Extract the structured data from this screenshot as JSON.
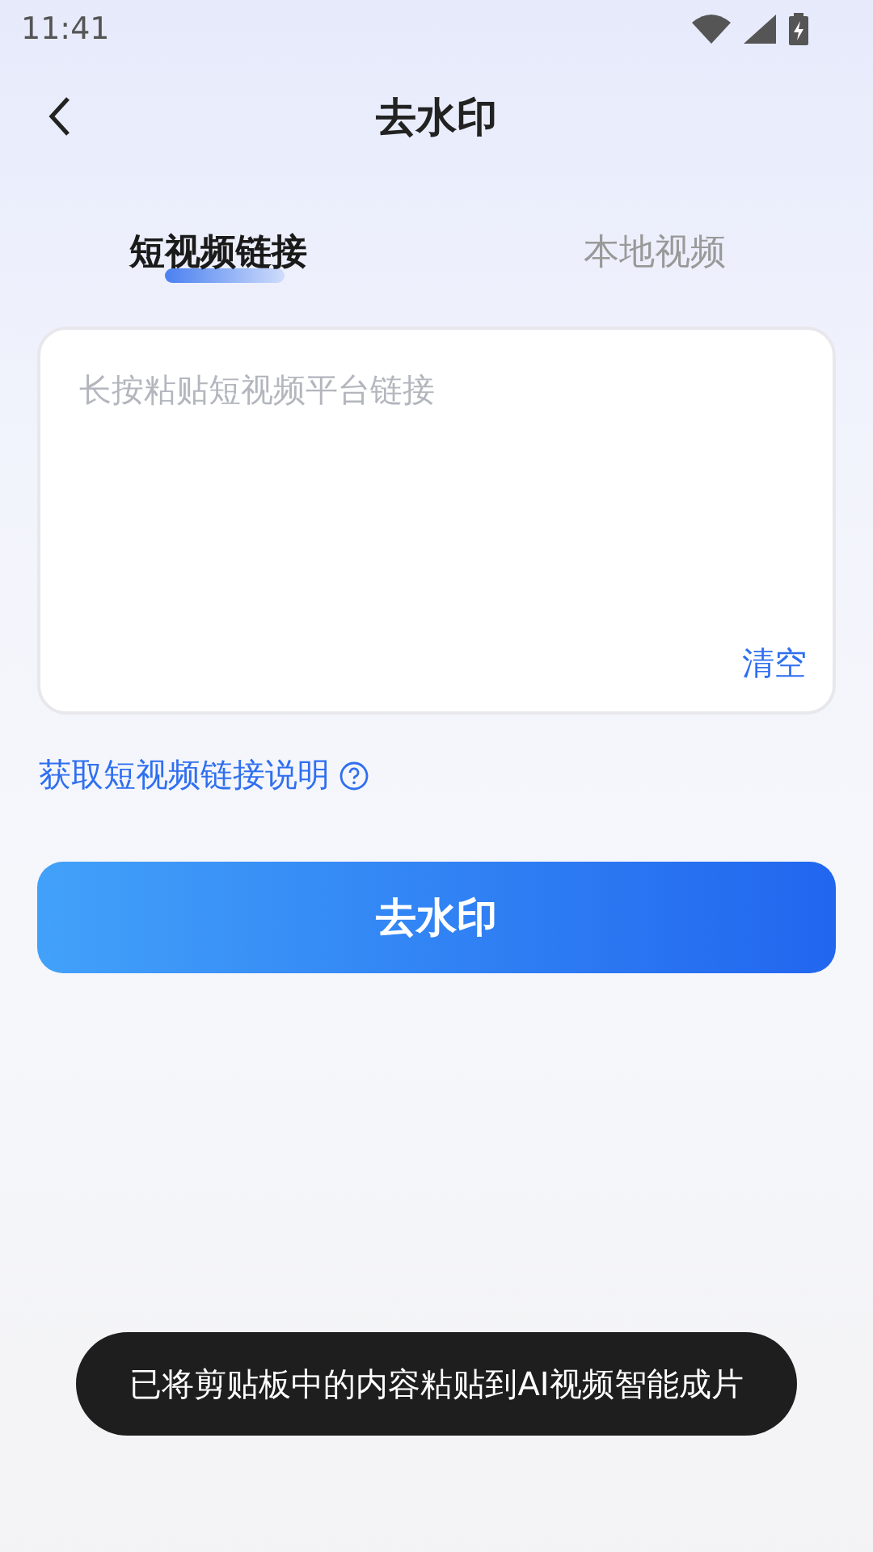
{
  "status_bar": {
    "time": "11:41"
  },
  "header": {
    "title": "去水印"
  },
  "tabs": [
    {
      "label": "短视频链接",
      "selected": true
    },
    {
      "label": "本地视频",
      "selected": false
    }
  ],
  "link_input": {
    "placeholder": "长按粘贴短视频平台链接",
    "clear": "清空"
  },
  "help_link": "获取短视频链接说明",
  "submit_button": "去水印",
  "toast": "已将剪贴板中的内容粘贴到AI视频智能成片"
}
